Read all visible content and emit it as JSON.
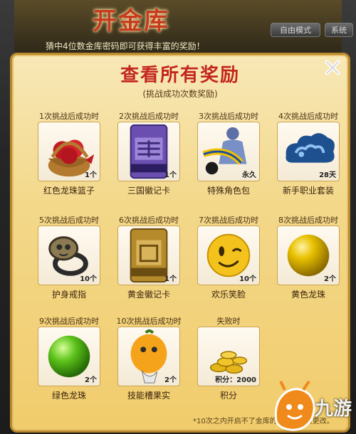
{
  "bg": {
    "title": "开金库",
    "subtitle": "猜中4位数金库密码即可获得丰富的奖励！",
    "btn1": "自由模式",
    "btn2": "系统"
  },
  "panel": {
    "title": "查看所有奖励",
    "subtitle": "(挑战成功次数奖励)",
    "note": "*10次之内开启不了金库的，密码会被更改。"
  },
  "rewards": [
    {
      "label": "1次挑战后成功时",
      "name": "红色龙珠篮子",
      "qty": "1个",
      "icon": "red-basket-icon"
    },
    {
      "label": "2次挑战后成功时",
      "name": "三国徽记卡",
      "qty": "1个",
      "icon": "kingdom-card-icon"
    },
    {
      "label": "3次挑战后成功时",
      "name": "特殊角色包",
      "qty": "永久",
      "icon": "special-character-icon"
    },
    {
      "label": "4次挑战后成功时",
      "name": "新手职业套装",
      "qty": "28天",
      "icon": "cloud-icon"
    },
    {
      "label": "5次挑战后成功时",
      "name": "护身戒指",
      "qty": "10个",
      "icon": "ring-icon"
    },
    {
      "label": "6次挑战后成功时",
      "name": "黄金徽记卡",
      "qty": "1个",
      "icon": "gold-card-icon"
    },
    {
      "label": "7次挑战后成功时",
      "name": "欢乐笑脸",
      "qty": "10个",
      "icon": "smiley-icon"
    },
    {
      "label": "8次挑战后成功时",
      "name": "黄色龙珠",
      "qty": "2个",
      "icon": "yellow-orb-icon"
    },
    {
      "label": "9次挑战后成功时",
      "name": "绿色龙珠",
      "qty": "2个",
      "icon": "green-orb-icon"
    },
    {
      "label": "10次挑战后成功时",
      "name": "技能槽果实",
      "qty": "2个",
      "icon": "fruit-icon"
    },
    {
      "label": "失败时",
      "name": "积分",
      "qty": "积分：2000",
      "icon": "coins-icon"
    }
  ],
  "watermark": {
    "text": "九游"
  }
}
